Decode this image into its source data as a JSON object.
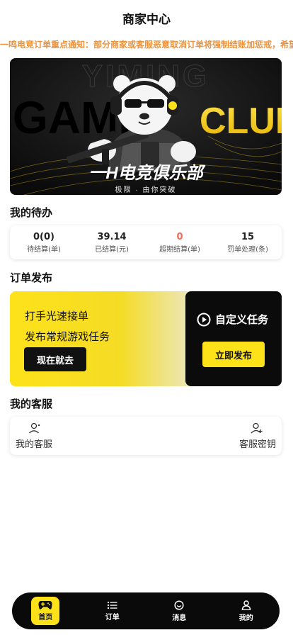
{
  "header": {
    "title": "商家中心"
  },
  "notice": {
    "text": "一鸣电竞订单重点通知：部分商家或客服恶意取消订单将强制结账加惩戒，希望"
  },
  "banner": {
    "word_left": "GAMI",
    "word_right": "CLUB",
    "watermark": "YIMING",
    "club_name": "一H电竞俱乐部",
    "slogan": "极限 · 由你突破",
    "accent": "#fde21a"
  },
  "todo": {
    "title": "我的待办",
    "items": [
      {
        "value": "0(0)",
        "label": "待结算(单)",
        "highlight": false
      },
      {
        "value": "39.14",
        "label": "已结算(元)",
        "highlight": false
      },
      {
        "value": "0",
        "label": "超期结算(单)",
        "highlight": true
      },
      {
        "value": "15",
        "label": "罚单处理(条)",
        "highlight": false
      }
    ]
  },
  "order": {
    "title": "订单发布",
    "line1": "打手光速接单",
    "line2": "发布常规游戏任务",
    "go_label": "现在就去",
    "custom_label": "自定义任务",
    "custom_icon": "play-circle-icon",
    "publish_label": "立即发布"
  },
  "service": {
    "title": "我的客服",
    "left": {
      "label": "我的客服",
      "icon": "user-headset-icon"
    },
    "right": {
      "label": "客服密钥",
      "icon": "user-add-icon"
    }
  },
  "tabs": [
    {
      "label": "首页",
      "icon": "gamepad-icon",
      "active": true
    },
    {
      "label": "订单",
      "icon": "list-icon",
      "active": false
    },
    {
      "label": "消息",
      "icon": "message-smile-icon",
      "active": false
    },
    {
      "label": "我的",
      "icon": "user-icon",
      "active": false
    }
  ],
  "colors": {
    "accent": "#fde21a",
    "notice": "#f0923a",
    "warning_value": "#ef6a5a",
    "dark": "#0b0b0b"
  }
}
